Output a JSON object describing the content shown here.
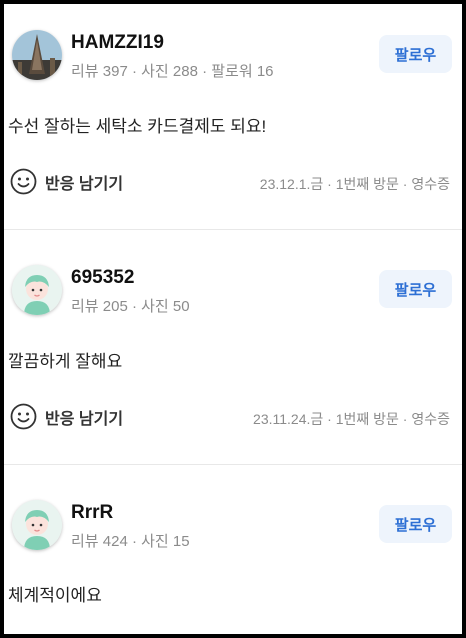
{
  "reviews": [
    {
      "username": "HAMZZI19",
      "stats": "리뷰 397 · 사진 288 · 팔로워 16",
      "follow_label": "팔로우",
      "text": "수선 잘하는 세탁소 카드결제도 되요!",
      "react_label": "반응 남기기",
      "meta": "23.12.1.금 · 1번째 방문 · 영수증",
      "avatar_icon": "photo-avatar"
    },
    {
      "username": "695352",
      "stats": "리뷰 205 · 사진 50",
      "follow_label": "팔로우",
      "text": "깔끔하게 잘해요",
      "react_label": "반응 남기기",
      "meta": "23.11.24.금 · 1번째 방문 · 영수증",
      "avatar_icon": "default-avatar"
    },
    {
      "username": "RrrR",
      "stats": "리뷰 424 · 사진 15",
      "follow_label": "팔로우",
      "text": "체계적이에요",
      "avatar_icon": "default-avatar"
    }
  ],
  "colors": {
    "follow_text": "#2d6fd4",
    "follow_bg": "#eef4fc",
    "muted": "#8b8b8b"
  }
}
